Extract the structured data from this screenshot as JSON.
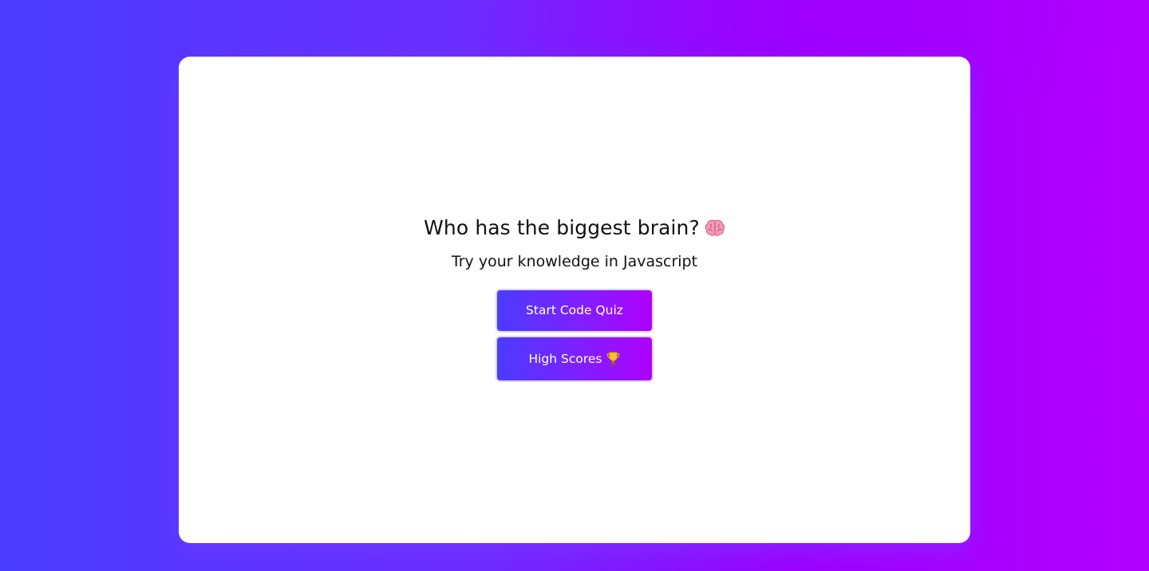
{
  "welcome": {
    "title": "Who has the biggest brain?",
    "title_icon": "brain-icon",
    "subtitle": "Try your knowledge in Javascript"
  },
  "actions": {
    "start_label": "Start Code Quiz",
    "scores_label": "High Scores",
    "scores_icon": "trophy-icon"
  },
  "colors": {
    "gradient_start": "#4a3cff",
    "gradient_end": "#b300ff",
    "card_bg": "#ffffff"
  }
}
